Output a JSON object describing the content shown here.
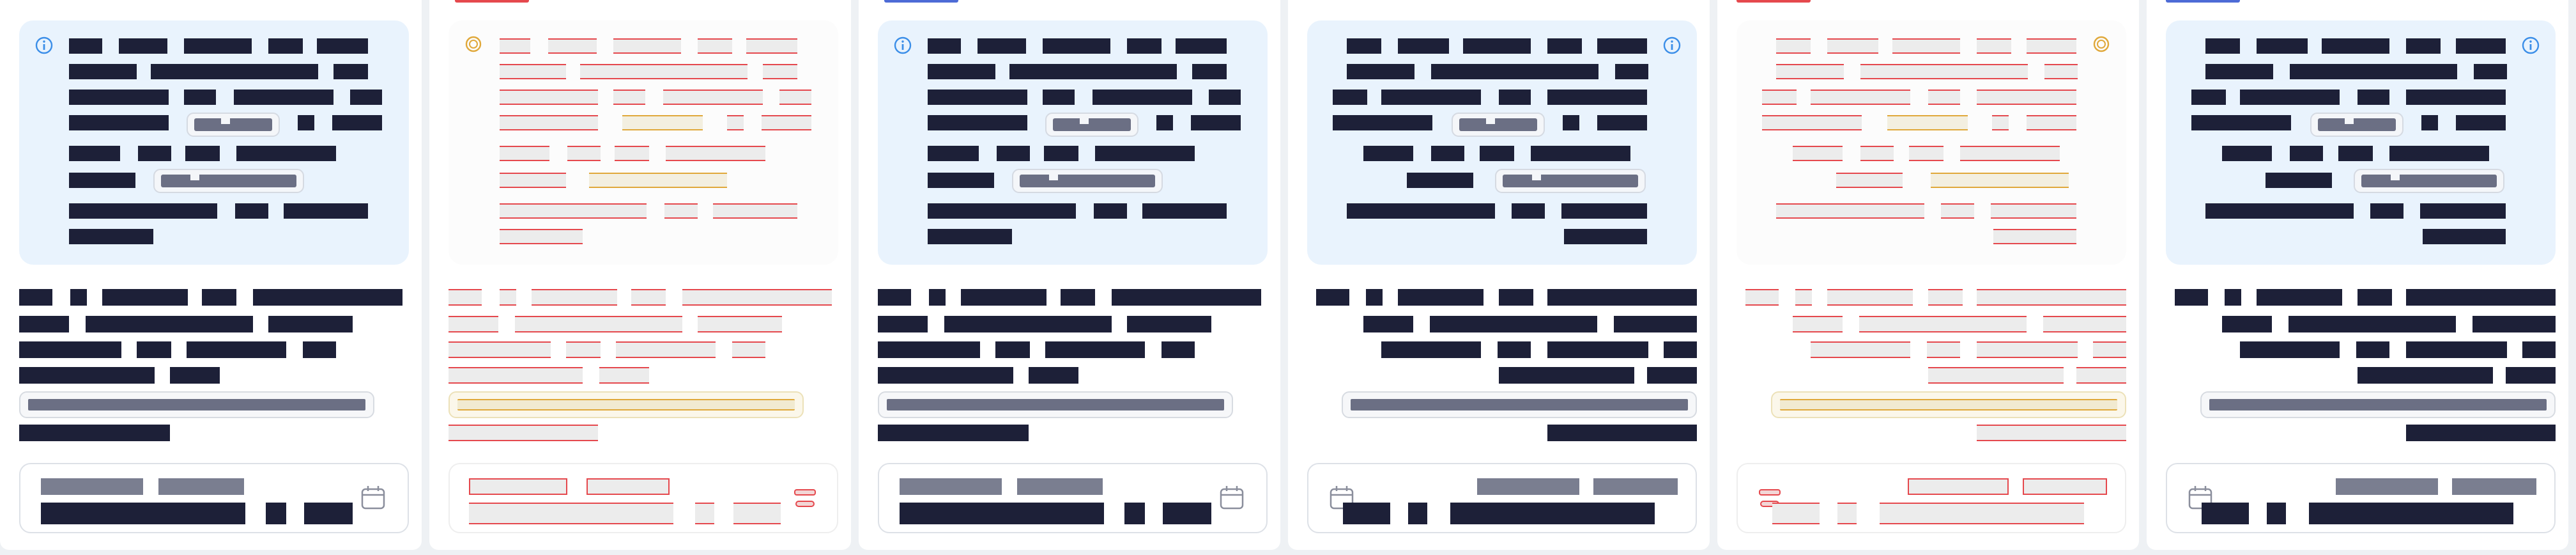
{
  "screenshot": {
    "description_free": true
  },
  "panels": [
    {
      "kind": "info",
      "tab": "none",
      "align": "left"
    },
    {
      "kind": "review",
      "tab": "red",
      "align": "left"
    },
    {
      "kind": "info",
      "tab": "blue",
      "align": "left"
    },
    {
      "kind": "info",
      "tab": "none",
      "align": "right"
    },
    {
      "kind": "review",
      "tab": "red",
      "align": "right"
    },
    {
      "kind": "info",
      "tab": "blue",
      "align": "right"
    }
  ],
  "icons": {
    "info": "info-icon",
    "review": "ring-icon",
    "date": "calendar-icon"
  },
  "colors": {
    "info_card_bg": "#e9f3fd",
    "info_icon": "#3b8ee8",
    "review_icon": "#e0a83a",
    "redacted_text": "#1d2038",
    "review_mark": "#e5484d",
    "review_highlight": "#e0a83a",
    "tab_red": "#e5484d",
    "tab_blue": "#4d6bd6"
  }
}
